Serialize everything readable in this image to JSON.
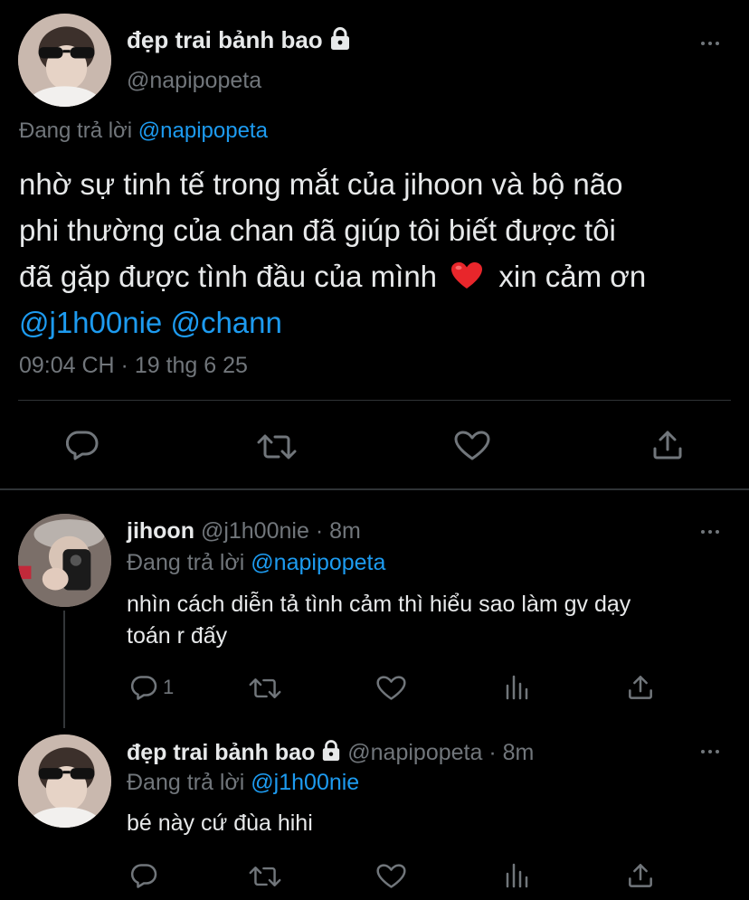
{
  "main_tweet": {
    "display_name": "đẹp trai bảnh bao",
    "handle": "@napipopeta",
    "replying_label": "Đang trả lời",
    "replying_to": "@napipopeta",
    "text_lines": [
      "nhờ sự tinh tế trong mắt của jihoon và bộ não",
      "phi thường của chan đã giúp tôi biết được tôi",
      "đã gặp được tình đầu của mình"
    ],
    "heart_emoji": "❤️",
    "text_after_emoji": "xin cảm ơn",
    "mentions": [
      "@j1h00nie",
      "@chann"
    ],
    "timestamp": "09:04 CH · 19 thg 6 25"
  },
  "replies": [
    {
      "display_name": "jihoon",
      "handle": "@j1h00nie",
      "time": "· 8m",
      "replying_label": "Đang trả lời",
      "replying_to": "@napipopeta",
      "text_lines": [
        "nhìn cách diễn tả tình cảm thì hiểu sao làm gv dạy",
        "toán r đấy"
      ],
      "reply_count": "1"
    },
    {
      "display_name": "đẹp trai bảnh bao",
      "handle": "@napipopeta",
      "time": "· 8m",
      "replying_label": "Đang trả lời",
      "replying_to": "@j1h00nie",
      "text_lines": [
        "bé này cứ đùa hihi"
      ],
      "reply_count": ""
    }
  ],
  "colors": {
    "background": "#000000",
    "text": "#e7e9ea",
    "muted": "#71767b",
    "link": "#1d9bf0",
    "divider": "#2f3336",
    "heart": "#e8262b"
  },
  "icons": {
    "reply": "reply-icon",
    "retweet": "retweet-icon",
    "like": "heart-icon",
    "share": "share-icon",
    "views": "analytics-icon",
    "more": "more-icon",
    "lock": "lock-icon"
  }
}
